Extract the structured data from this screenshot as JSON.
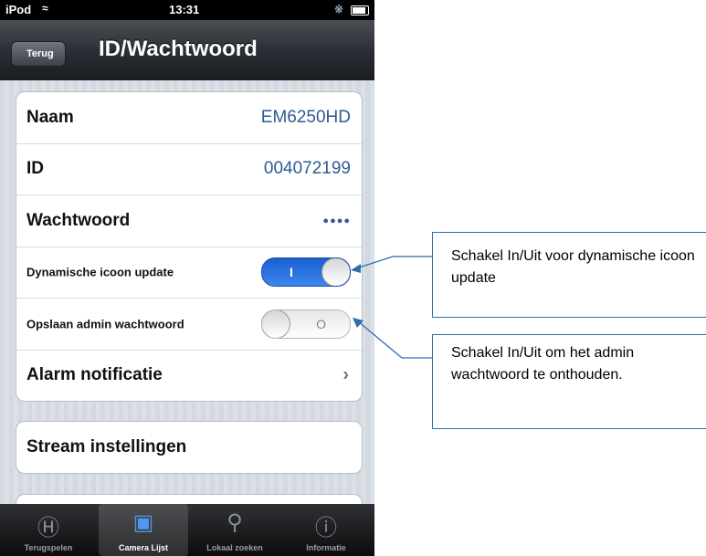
{
  "status_bar": {
    "carrier": "iPod",
    "time": "13:31"
  },
  "nav": {
    "back_label": "Terug",
    "title": "ID/Wachtwoord"
  },
  "settings": {
    "name": {
      "label": "Naam",
      "value": "EM6250HD"
    },
    "id": {
      "label": "ID",
      "value": "004072199"
    },
    "password": {
      "label": "Wachtwoord",
      "value": "●●●●"
    },
    "dynamic_icon": {
      "label": "Dynamische icoon update",
      "state": "on",
      "glyph": "I"
    },
    "save_admin_password": {
      "label": "Opslaan admin wachtwoord",
      "state": "off",
      "glyph": "O"
    },
    "alarm": {
      "label": "Alarm notificatie"
    },
    "stream": {
      "label": "Stream instellingen"
    }
  },
  "tabs": [
    {
      "label": "Terugspelen",
      "icon": "playback-icon"
    },
    {
      "label": "Camera Lijst",
      "icon": "camera-list-icon",
      "active": true
    },
    {
      "label": "Lokaal zoeken",
      "icon": "search-icon"
    },
    {
      "label": "Informatie",
      "icon": "info-icon"
    }
  ],
  "annotations": [
    {
      "text": "Schakel In/Uit voor dynamische icoon update"
    },
    {
      "text": "Schakel In/Uit om het admin wachtwoord te onthouden."
    }
  ],
  "colors": {
    "accent": "#2f6cb0",
    "toggle_on": "#2a72e0",
    "value_text": "#2f5a93"
  }
}
